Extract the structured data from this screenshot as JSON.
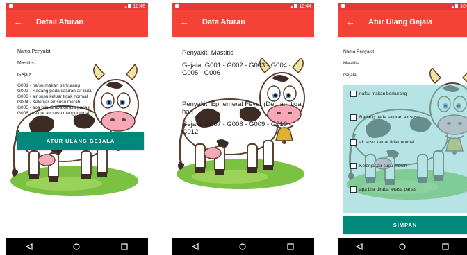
{
  "status": {
    "time1": "10:46",
    "time2": "10:44",
    "time3": "10:"
  },
  "screen1": {
    "title": "Detail Aturan",
    "label_penyakit": "Nama Penyakit",
    "value_penyakit": "Mastitis",
    "label_gejala": "Gejala",
    "gejala": [
      "G001 - nafsu makan berkurang",
      "G002 - Radang pada saluran air susu",
      "G003 - air susu keluar tidak normal",
      "G004 - Kelenjar air susu merah",
      "G005 - apa bila diraba terasa panas",
      "G006 - keluar air susu menggumpal"
    ],
    "button": "ATUR ULANG GEJALA"
  },
  "screen2": {
    "title": "Data Aturan",
    "p1": "Penyakit: Mastitis",
    "g1": "Gejala: G001 - G002 - G003 - G004 - G005 - G006",
    "p2": "Penyakit: Ephemeral Fever (Demam tiga hari",
    "g2": "Gejala: G007 - G008 - G009 - G010 - G012"
  },
  "screen3": {
    "title": "Atur Ulang Gejala",
    "label_penyakit": "Nama Penyakit",
    "value_penyakit": "Mastitis",
    "label_gejala": "Gejala",
    "checkboxes": [
      "nafsu makan berkurang",
      "Radang pada saluran air susu",
      "air susu keluar tidak normal",
      "Kelenjar air susu merah",
      "apa bila diraba terasa panas"
    ],
    "button": "SIMPAN"
  },
  "icons": {
    "back": "back-arrow-icon",
    "nav_back": "triangle-back-icon",
    "nav_home": "circle-home-icon",
    "nav_recent": "square-recent-icon"
  },
  "colors": {
    "appbar": "#f44336",
    "statusbar": "#e53935",
    "button": "#00897b"
  }
}
